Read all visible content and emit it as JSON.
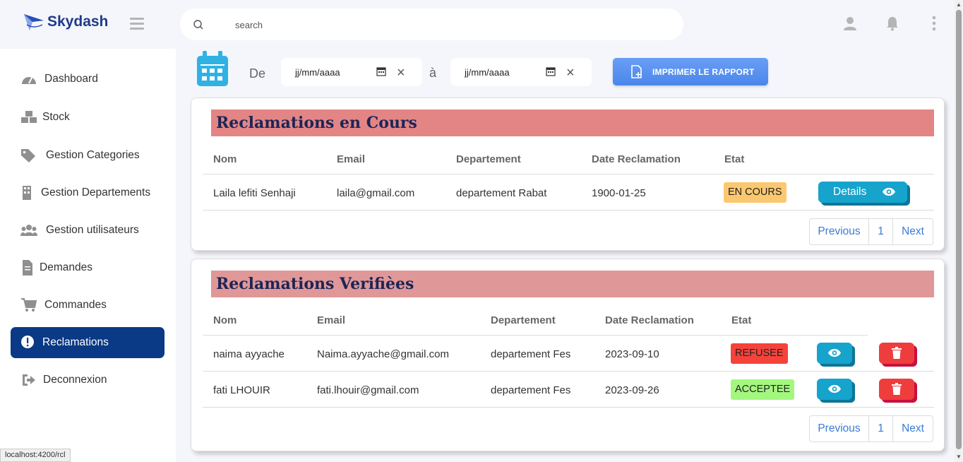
{
  "brand": {
    "name": "Skydash"
  },
  "search": {
    "placeholder": "search"
  },
  "sidebar": {
    "items": [
      {
        "label": "Dashboard",
        "icon": "dashboard-icon"
      },
      {
        "label": "Stock",
        "icon": "boxes-icon"
      },
      {
        "label": "Gestion Categories",
        "icon": "tags-icon"
      },
      {
        "label": "Gestion Departements",
        "icon": "building-icon"
      },
      {
        "label": "Gestion utilisateurs",
        "icon": "users-icon"
      },
      {
        "label": "Demandes",
        "icon": "document-icon"
      },
      {
        "label": "Commandes",
        "icon": "cart-icon"
      },
      {
        "label": "Reclamations",
        "icon": "exclamation-circle-icon",
        "active": true
      },
      {
        "label": "Deconnexion",
        "icon": "logout-icon"
      }
    ]
  },
  "filter": {
    "from_label": "De",
    "to_label": "à",
    "from_value": "jj/mm/aaaa",
    "to_value": "jj/mm/aaaa",
    "print_label": "IMPRIMER LE RAPPORT"
  },
  "card1": {
    "title": "Reclamations en Cours",
    "columns": [
      "Nom",
      "Email",
      "Departement",
      "Date Reclamation",
      "Etat"
    ],
    "rows": [
      {
        "nom": "Laila lefiti Senhaji",
        "email": "laila@gmail.com",
        "departement": "departement Rabat",
        "date": "1900-01-25",
        "etat": "EN COURS",
        "action": "Details"
      }
    ],
    "pager": {
      "prev": "Previous",
      "page": "1",
      "next": "Next"
    }
  },
  "card2": {
    "title": "Reclamations Verifièes",
    "columns": [
      "Nom",
      "Email",
      "Departement",
      "Date Reclamation",
      "Etat"
    ],
    "rows": [
      {
        "nom": "naima ayyache",
        "email": "Naima.ayyache@gmail.com",
        "departement": "departement Fes",
        "date": "2023-09-10",
        "etat": "REFUSEE"
      },
      {
        "nom": "fati LHOUIR",
        "email": "fati.lhouir@gmail.com",
        "departement": "departement Fes",
        "date": "2023-09-26",
        "etat": "ACCEPTEE"
      }
    ],
    "pager": {
      "prev": "Previous",
      "page": "1",
      "next": "Next"
    }
  },
  "status_bar": {
    "url": "localhost:4200/rcl"
  },
  "colors": {
    "brand": "#1f3a8a",
    "active_nav": "#0a3985",
    "card1_header": "#e38585",
    "card2_header": "#e09797",
    "badge_en_cours": "#fbc86f",
    "badge_refusee": "#f4433b",
    "badge_acceptee": "#a3f77e",
    "button_info": "#16a3cc",
    "button_danger": "#ef3d3d"
  }
}
